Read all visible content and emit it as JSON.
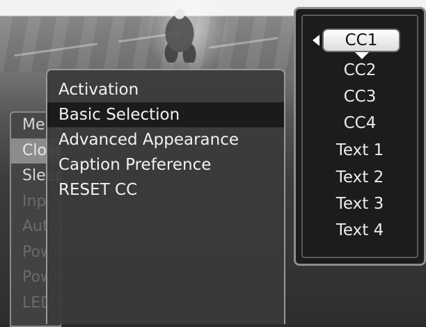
{
  "main_menu": {
    "items": [
      {
        "label": "Menu Language"
      },
      {
        "label": "Closed Caption"
      },
      {
        "label": "Sleep Timer"
      },
      {
        "label": "Input Labels"
      },
      {
        "label": "Auto-Source"
      },
      {
        "label": "Power Mode"
      },
      {
        "label": "Power On plug"
      },
      {
        "label": "LED Set"
      }
    ]
  },
  "sub_menu": {
    "items": [
      {
        "label": "Activation"
      },
      {
        "label": "Basic Selection"
      },
      {
        "label": "Advanced Appearance"
      },
      {
        "label": "Caption Preference"
      },
      {
        "label": "RESET CC"
      }
    ]
  },
  "cc_selector": {
    "selected": "CC1",
    "options": [
      "CC2",
      "CC3",
      "CC4",
      "Text 1",
      "Text 2",
      "Text 3",
      "Text 4"
    ]
  },
  "colors": {
    "highlight": "#1b1b1b",
    "panel": "#1c1c1c",
    "selected_option": "#ffffff"
  }
}
